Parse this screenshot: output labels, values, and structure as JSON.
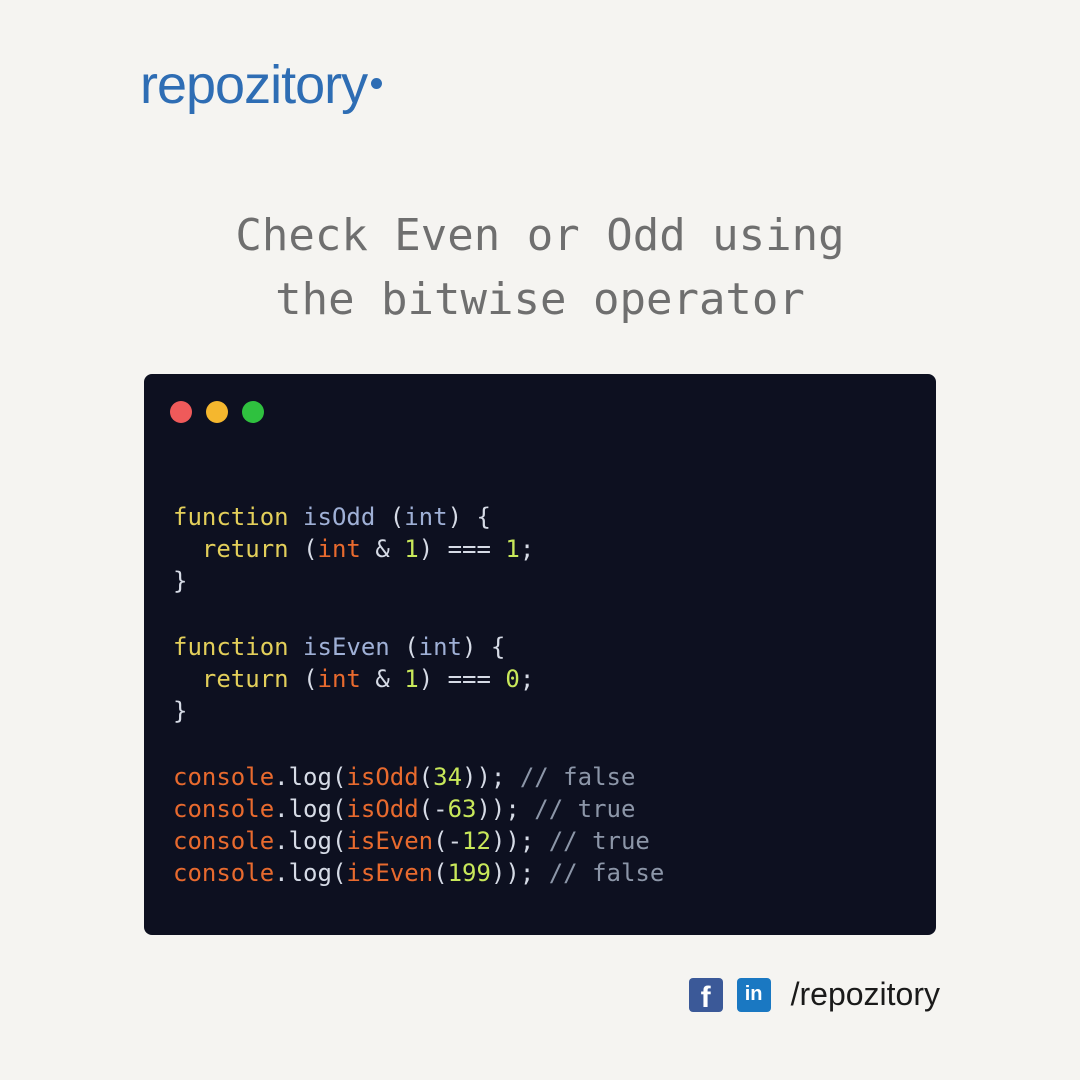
{
  "brand": {
    "logo_text": "repozitory",
    "color": "#2e6db4"
  },
  "headline": {
    "line1": "Check Even or Odd using",
    "line2": "the bitwise operator"
  },
  "window": {
    "controls": [
      {
        "name": "close",
        "color": "#ef5a5a"
      },
      {
        "name": "minimize",
        "color": "#f5b72e"
      },
      {
        "name": "maximize",
        "color": "#2fc13f"
      }
    ]
  },
  "code": {
    "keyword_function": "function",
    "keyword_return": "return",
    "fn_is_odd": "isOdd",
    "fn_is_even": "isEven",
    "param": "int",
    "object": "console",
    "method": "log",
    "literals": {
      "one": "1",
      "zero": "0",
      "n34": "34",
      "n63": "63",
      "n12": "12",
      "n199": "199"
    },
    "comments": {
      "c1": "// false",
      "c2": "// true",
      "c3": "// true",
      "c4": "// false"
    }
  },
  "footer": {
    "facebook_glyph": "f",
    "linkedin_glyph": "in",
    "handle": "/repozitory"
  }
}
